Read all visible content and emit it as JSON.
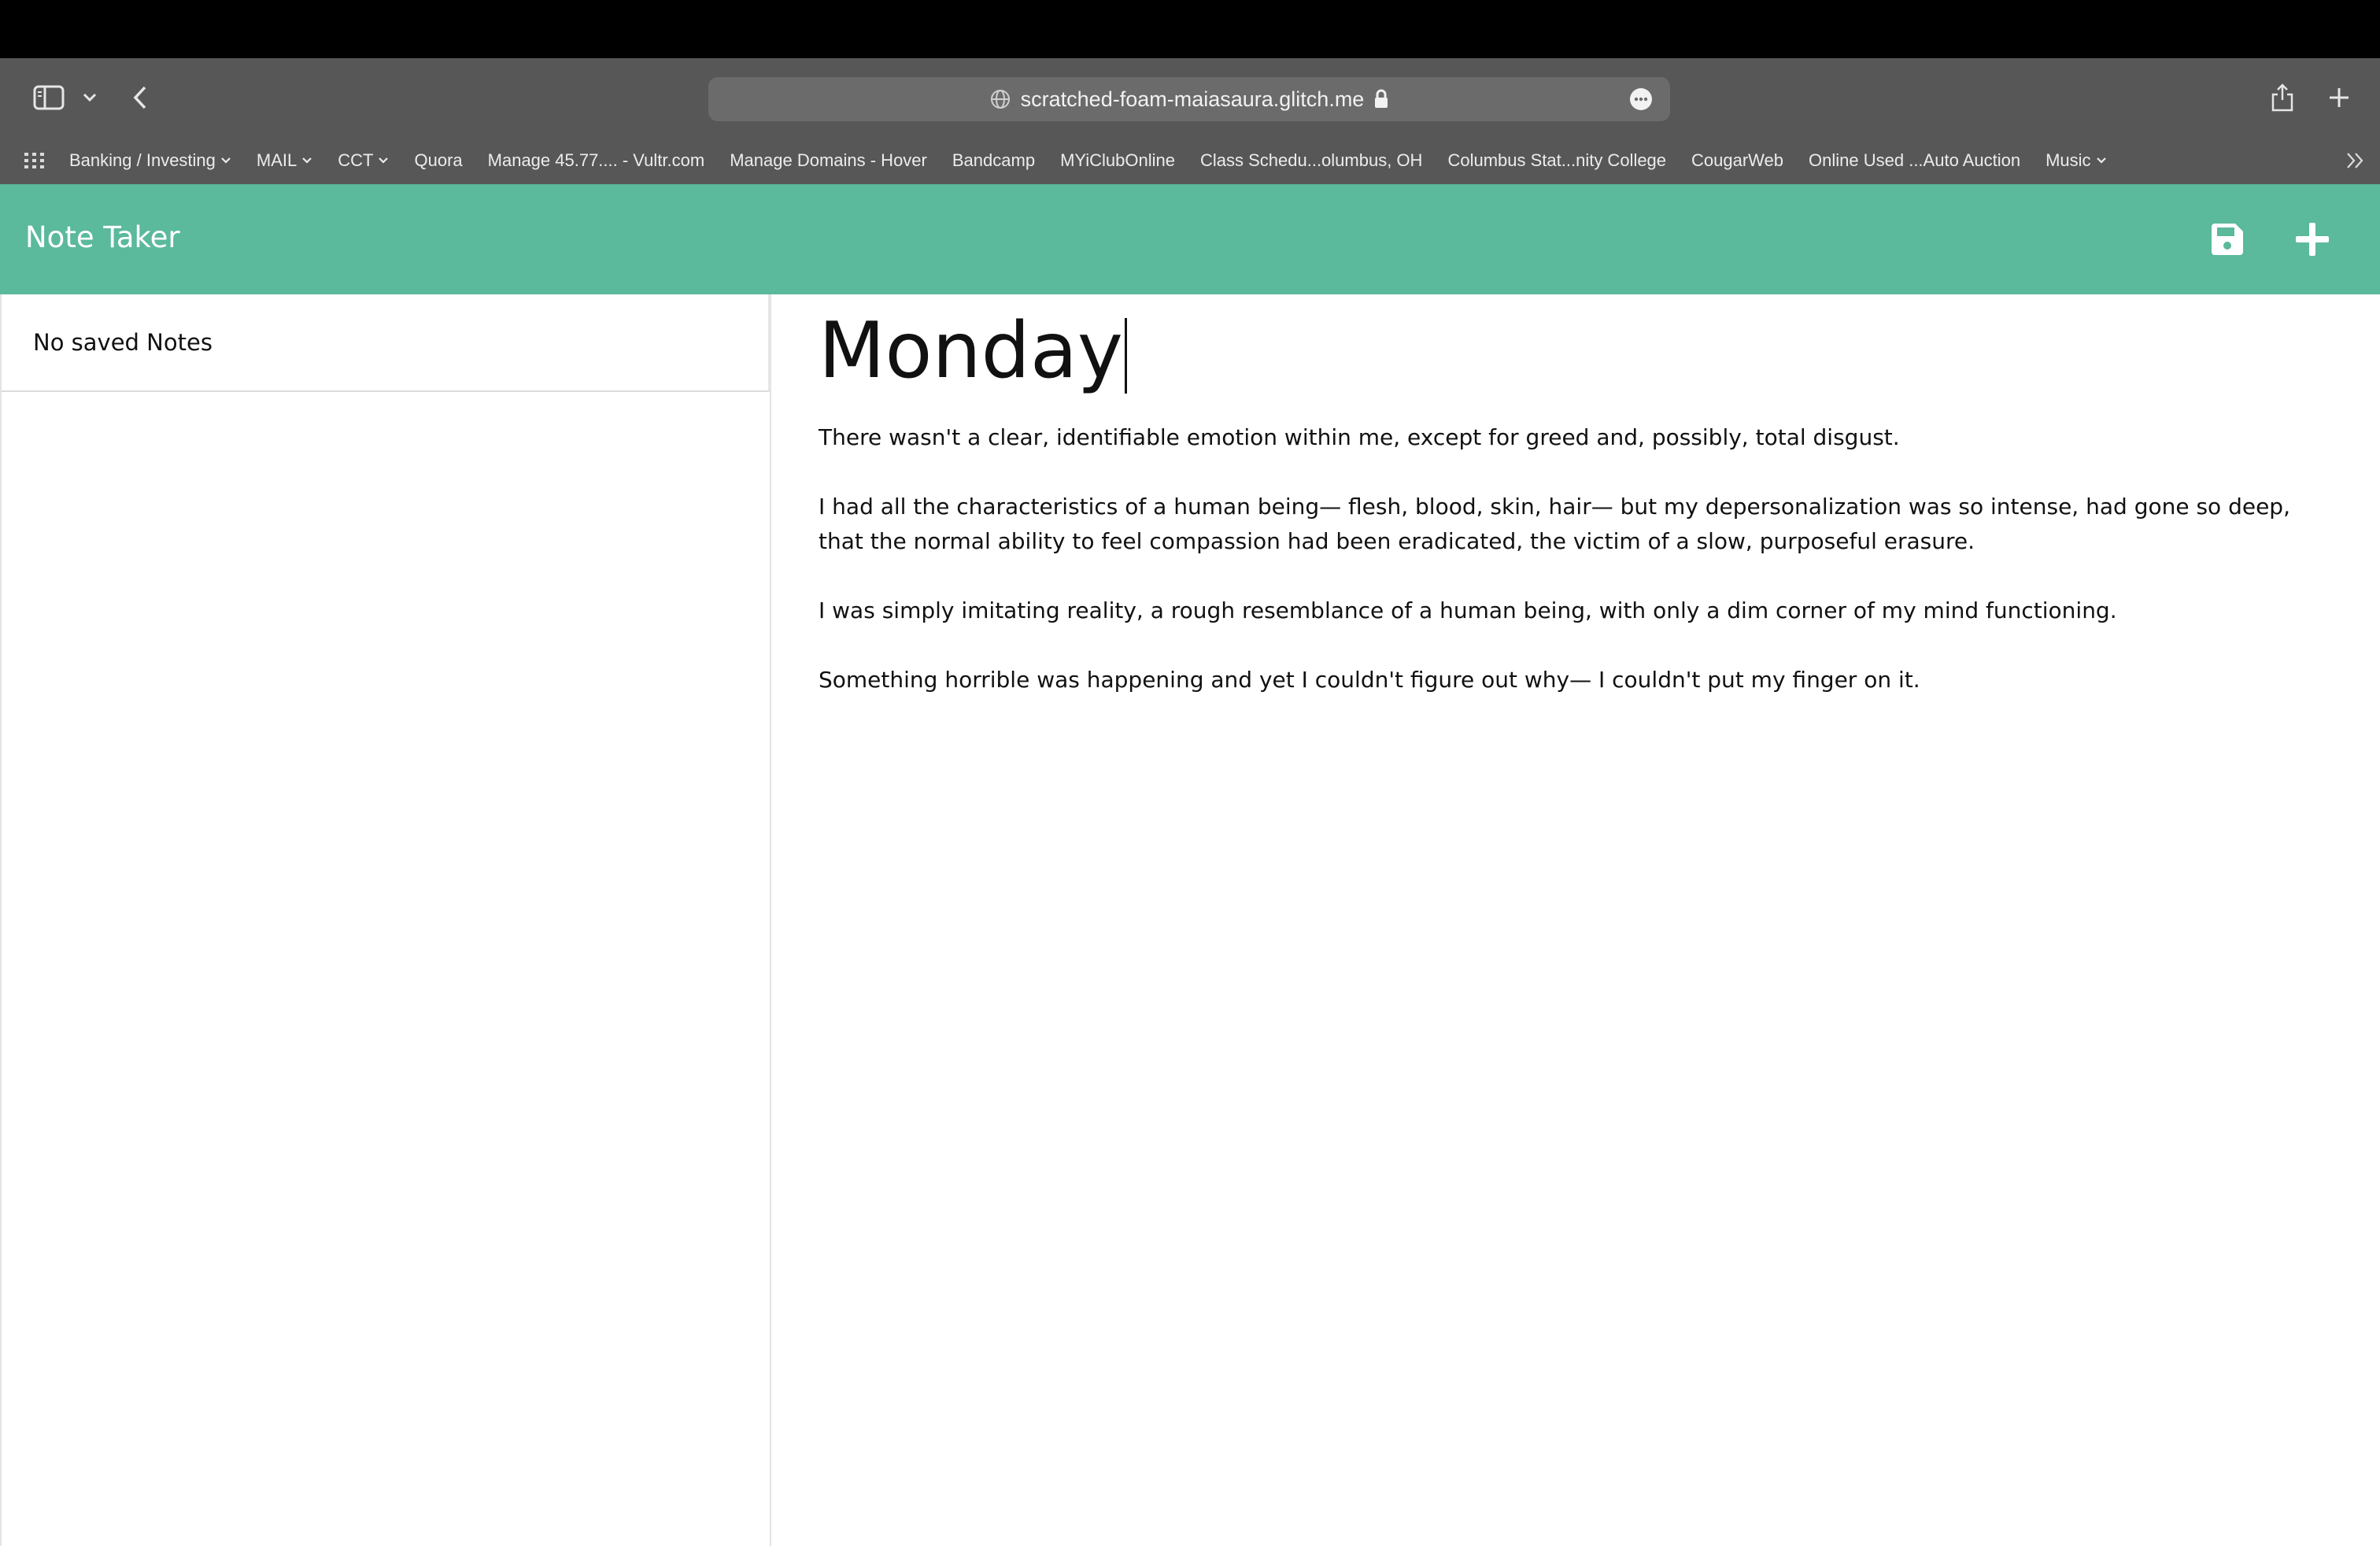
{
  "browser": {
    "url": "scratched-foam-maiasaura.glitch.me",
    "bookmarks": [
      {
        "label": "Banking / Investing",
        "has_menu": true
      },
      {
        "label": "MAIL",
        "has_menu": true
      },
      {
        "label": "CCT",
        "has_menu": true
      },
      {
        "label": "Quora",
        "has_menu": false
      },
      {
        "label": "Manage 45.77.... - Vultr.com",
        "has_menu": false
      },
      {
        "label": "Manage Domains - Hover",
        "has_menu": false
      },
      {
        "label": "Bandcamp",
        "has_menu": false
      },
      {
        "label": "MYiClubOnline",
        "has_menu": false
      },
      {
        "label": "Class Schedu...olumbus, OH",
        "has_menu": false
      },
      {
        "label": "Columbus Stat...nity College",
        "has_menu": false
      },
      {
        "label": "CougarWeb",
        "has_menu": false
      },
      {
        "label": "Online Used ...Auto Auction",
        "has_menu": false
      },
      {
        "label": "Music",
        "has_menu": true
      }
    ]
  },
  "app": {
    "title": "Note Taker",
    "accent_color": "#5bb99c",
    "save_icon": "save-icon",
    "new_icon": "plus-icon"
  },
  "sidebar": {
    "empty_message": "No saved Notes"
  },
  "note": {
    "title": "Monday",
    "paragraphs": [
      "There wasn't a clear, identifiable emotion within me, except for greed and, possibly, total disgust.",
      "I had all the characteristics of a human being— flesh, blood, skin, hair— but my depersonalization was so intense, had gone so deep, that the normal ability to feel compassion had been eradicated, the victim of a slow, purposeful erasure.",
      "I was simply imitating reality, a rough resemblance of a human being, with only a dim corner of my mind functioning.",
      "Something horrible was happening and yet I couldn't figure out why— I couldn't put my finger on it."
    ]
  }
}
